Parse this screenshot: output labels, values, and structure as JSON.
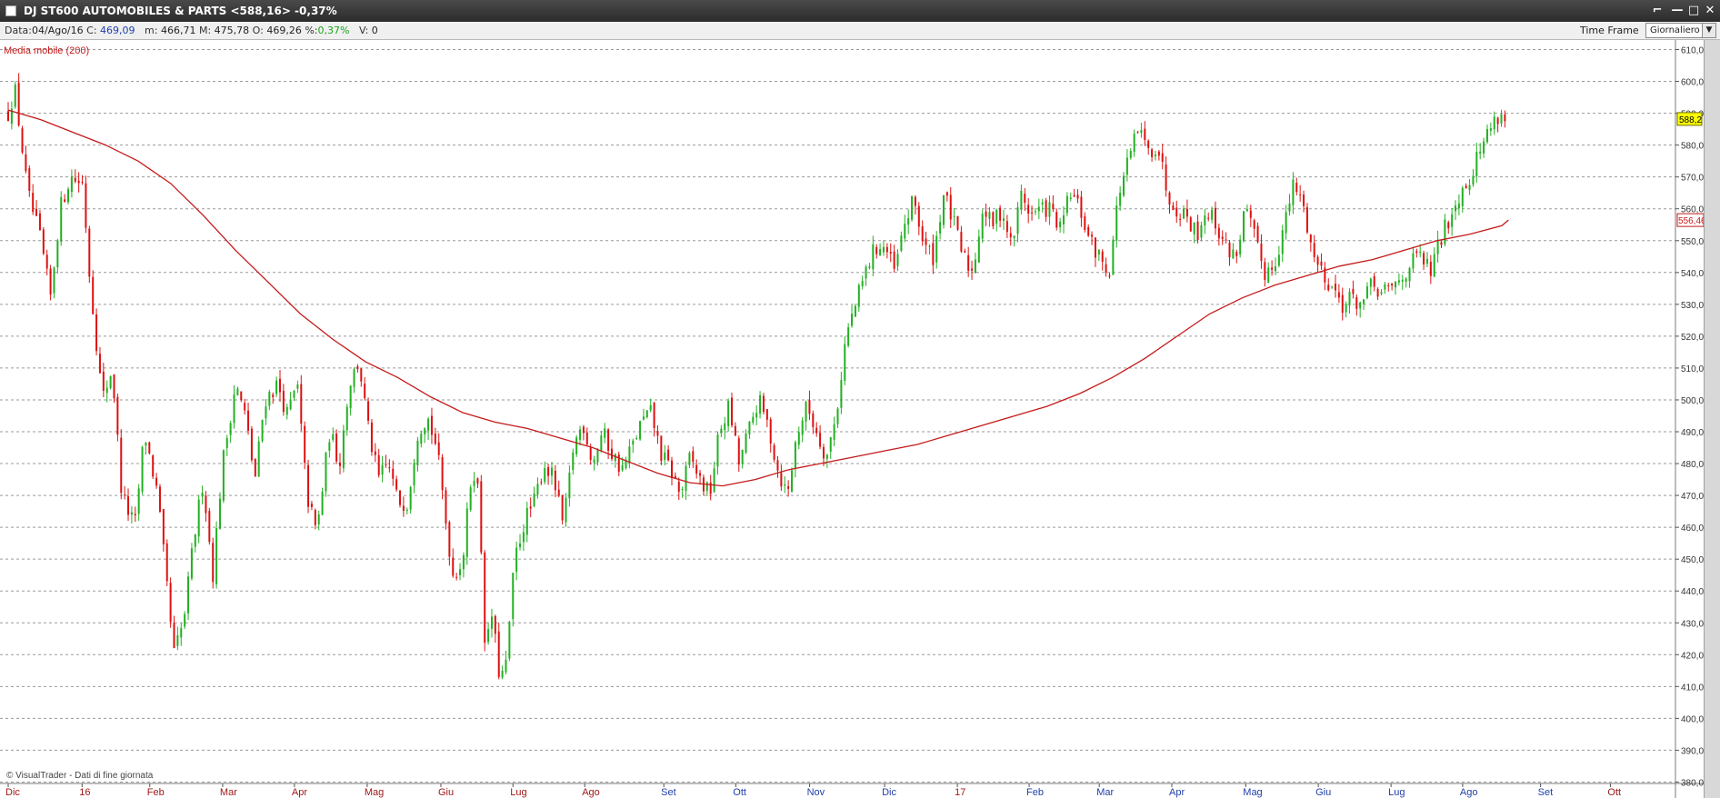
{
  "window": {
    "title": "DJ ST600 AUTOMOBILES & PARTS <588,16> -0,37%",
    "controls": {
      "tool": "⌐",
      "minimize": "—",
      "maximize": "□",
      "close": "✕"
    }
  },
  "infobar": {
    "date_label": "Data:",
    "date_value": "04/Ago/16",
    "close_label": "C:",
    "close_value": "469,09",
    "min_label": "m:",
    "min_value": "466,71",
    "max_label": "M:",
    "max_value": "475,78",
    "open_label": "O:",
    "open_value": "469,26",
    "change_label": "%:",
    "change_value": "0,37%",
    "volume_label": "V:",
    "volume_value": "0",
    "timeframe_label": "Time Frame",
    "timeframe_value": "Giornaliero"
  },
  "colors": {
    "up": "#22b022",
    "down": "#dd1111",
    "ma_line": "#c41a1a",
    "grid": "#9a9a9a",
    "last_price_bg": "#ffff00"
  },
  "chart_data": {
    "type": "candlestick",
    "instrument": "DJ ST600 AUTOMOBILES & PARTS",
    "indicator_label": "Media mobile (200)",
    "footer": "© VisualTrader - Dati di fine giornata",
    "ylim": [
      375,
      613
    ],
    "y_ticks": [
      "380,0",
      "390,0",
      "400,0",
      "410,0",
      "420,0",
      "430,0",
      "440,0",
      "450,0",
      "460,0",
      "470,0",
      "480,0",
      "490,0",
      "500,0",
      "510,0",
      "520,0",
      "530,0",
      "540,0",
      "550,0",
      "560,0",
      "570,0",
      "580,0",
      "590,0",
      "600,0",
      "610,0"
    ],
    "x_ticks": [
      {
        "label": "Dic",
        "t": 0,
        "blue": false
      },
      {
        "label": "16",
        "t": 0.0455,
        "blue": false
      },
      {
        "label": "Feb",
        "t": 0.0872,
        "blue": false
      },
      {
        "label": "Mar",
        "t": 0.1321,
        "blue": false
      },
      {
        "label": "Apr",
        "t": 0.1763,
        "blue": false
      },
      {
        "label": "Mag",
        "t": 0.2211,
        "blue": false
      },
      {
        "label": "Giu",
        "t": 0.2665,
        "blue": false
      },
      {
        "label": "Lug",
        "t": 0.3109,
        "blue": false
      },
      {
        "label": "Ago",
        "t": 0.3551,
        "blue": false
      },
      {
        "label": "Set",
        "t": 0.4038,
        "blue": true
      },
      {
        "label": "Ott",
        "t": 0.4481,
        "blue": true
      },
      {
        "label": "Nov",
        "t": 0.4936,
        "blue": true
      },
      {
        "label": "Dic",
        "t": 0.5398,
        "blue": true
      },
      {
        "label": "17",
        "t": 0.5846,
        "blue": false
      },
      {
        "label": "Feb",
        "t": 0.6288,
        "blue": true
      },
      {
        "label": "Mar",
        "t": 0.672,
        "blue": true
      },
      {
        "label": "Apr",
        "t": 0.7167,
        "blue": true
      },
      {
        "label": "Mag",
        "t": 0.7622,
        "blue": true
      },
      {
        "label": "Giu",
        "t": 0.8069,
        "blue": true
      },
      {
        "label": "Lug",
        "t": 0.8517,
        "blue": true
      },
      {
        "label": "Ago",
        "t": 0.8958,
        "blue": true
      },
      {
        "label": "Set",
        "t": 0.9438,
        "blue": true
      },
      {
        "label": "Ott",
        "t": 0.9868,
        "blue": false
      }
    ],
    "close_keypoints": [
      [
        0.0,
        590
      ],
      [
        0.004,
        598
      ],
      [
        0.012,
        565
      ],
      [
        0.02,
        550
      ],
      [
        0.026,
        532
      ],
      [
        0.032,
        560
      ],
      [
        0.038,
        570
      ],
      [
        0.046,
        568
      ],
      [
        0.05,
        540
      ],
      [
        0.058,
        500
      ],
      [
        0.064,
        510
      ],
      [
        0.07,
        470
      ],
      [
        0.078,
        460
      ],
      [
        0.084,
        490
      ],
      [
        0.092,
        470
      ],
      [
        0.096,
        450
      ],
      [
        0.102,
        420
      ],
      [
        0.108,
        430
      ],
      [
        0.114,
        455
      ],
      [
        0.12,
        475
      ],
      [
        0.126,
        445
      ],
      [
        0.132,
        480
      ],
      [
        0.14,
        505
      ],
      [
        0.146,
        495
      ],
      [
        0.152,
        475
      ],
      [
        0.158,
        500
      ],
      [
        0.166,
        505
      ],
      [
        0.172,
        495
      ],
      [
        0.178,
        505
      ],
      [
        0.184,
        470
      ],
      [
        0.19,
        458
      ],
      [
        0.198,
        490
      ],
      [
        0.204,
        480
      ],
      [
        0.21,
        505
      ],
      [
        0.216,
        512
      ],
      [
        0.222,
        490
      ],
      [
        0.228,
        475
      ],
      [
        0.234,
        480
      ],
      [
        0.24,
        468
      ],
      [
        0.246,
        468
      ],
      [
        0.252,
        490
      ],
      [
        0.258,
        495
      ],
      [
        0.264,
        485
      ],
      [
        0.27,
        460
      ],
      [
        0.274,
        445
      ],
      [
        0.28,
        450
      ],
      [
        0.286,
        480
      ],
      [
        0.29,
        470
      ],
      [
        0.294,
        420
      ],
      [
        0.298,
        433
      ],
      [
        0.302,
        415
      ],
      [
        0.306,
        413
      ],
      [
        0.312,
        450
      ],
      [
        0.318,
        462
      ],
      [
        0.324,
        468
      ],
      [
        0.33,
        480
      ],
      [
        0.336,
        475
      ],
      [
        0.342,
        460
      ],
      [
        0.348,
        485
      ],
      [
        0.354,
        493
      ],
      [
        0.36,
        480
      ],
      [
        0.366,
        490
      ],
      [
        0.372,
        483
      ],
      [
        0.378,
        478
      ],
      [
        0.384,
        485
      ],
      [
        0.39,
        493
      ],
      [
        0.396,
        496
      ],
      [
        0.402,
        483
      ],
      [
        0.408,
        478
      ],
      [
        0.414,
        470
      ],
      [
        0.42,
        482
      ],
      [
        0.426,
        475
      ],
      [
        0.432,
        470
      ],
      [
        0.438,
        490
      ],
      [
        0.444,
        498
      ],
      [
        0.45,
        480
      ],
      [
        0.456,
        490
      ],
      [
        0.462,
        500
      ],
      [
        0.468,
        492
      ],
      [
        0.474,
        478
      ],
      [
        0.48,
        470
      ],
      [
        0.486,
        490
      ],
      [
        0.492,
        498
      ],
      [
        0.498,
        490
      ],
      [
        0.504,
        482
      ],
      [
        0.51,
        495
      ],
      [
        0.516,
        520
      ],
      [
        0.522,
        530
      ],
      [
        0.528,
        540
      ],
      [
        0.534,
        548
      ],
      [
        0.54,
        548
      ],
      [
        0.546,
        540
      ],
      [
        0.552,
        555
      ],
      [
        0.558,
        563
      ],
      [
        0.564,
        548
      ],
      [
        0.57,
        545
      ],
      [
        0.576,
        565
      ],
      [
        0.582,
        556
      ],
      [
        0.588,
        545
      ],
      [
        0.594,
        540
      ],
      [
        0.6,
        560
      ],
      [
        0.606,
        555
      ],
      [
        0.612,
        560
      ],
      [
        0.618,
        548
      ],
      [
        0.624,
        565
      ],
      [
        0.63,
        558
      ],
      [
        0.636,
        560
      ],
      [
        0.642,
        560
      ],
      [
        0.648,
        553
      ],
      [
        0.654,
        565
      ],
      [
        0.66,
        560
      ],
      [
        0.666,
        550
      ],
      [
        0.672,
        545
      ],
      [
        0.678,
        540
      ],
      [
        0.684,
        565
      ],
      [
        0.69,
        575
      ],
      [
        0.696,
        585
      ],
      [
        0.702,
        578
      ],
      [
        0.708,
        580
      ],
      [
        0.714,
        565
      ],
      [
        0.72,
        560
      ],
      [
        0.726,
        558
      ],
      [
        0.732,
        552
      ],
      [
        0.738,
        560
      ],
      [
        0.744,
        555
      ],
      [
        0.75,
        548
      ],
      [
        0.756,
        545
      ],
      [
        0.762,
        560
      ],
      [
        0.768,
        550
      ],
      [
        0.774,
        540
      ],
      [
        0.78,
        543
      ],
      [
        0.786,
        555
      ],
      [
        0.792,
        568
      ],
      [
        0.798,
        560
      ],
      [
        0.804,
        545
      ],
      [
        0.81,
        540
      ],
      [
        0.816,
        535
      ],
      [
        0.822,
        530
      ],
      [
        0.828,
        532
      ],
      [
        0.834,
        530
      ],
      [
        0.84,
        536
      ],
      [
        0.846,
        533
      ],
      [
        0.852,
        535
      ],
      [
        0.858,
        538
      ],
      [
        0.864,
        543
      ],
      [
        0.87,
        545
      ],
      [
        0.876,
        540
      ],
      [
        0.882,
        550
      ],
      [
        0.888,
        558
      ],
      [
        0.894,
        565
      ],
      [
        0.9,
        570
      ],
      [
        0.906,
        578
      ],
      [
        0.912,
        585
      ],
      [
        0.918,
        590
      ],
      [
        0.924,
        588
      ]
    ],
    "ma_200": [
      [
        0.0,
        591
      ],
      [
        0.02,
        588
      ],
      [
        0.04,
        584
      ],
      [
        0.06,
        580
      ],
      [
        0.08,
        575
      ],
      [
        0.1,
        568
      ],
      [
        0.12,
        558
      ],
      [
        0.14,
        547
      ],
      [
        0.16,
        537
      ],
      [
        0.18,
        527
      ],
      [
        0.2,
        519
      ],
      [
        0.22,
        512
      ],
      [
        0.24,
        507
      ],
      [
        0.26,
        501
      ],
      [
        0.28,
        496
      ],
      [
        0.3,
        493
      ],
      [
        0.32,
        491
      ],
      [
        0.34,
        488
      ],
      [
        0.36,
        485
      ],
      [
        0.38,
        481
      ],
      [
        0.4,
        477
      ],
      [
        0.42,
        474
      ],
      [
        0.44,
        473
      ],
      [
        0.46,
        475
      ],
      [
        0.48,
        478
      ],
      [
        0.5,
        480
      ],
      [
        0.52,
        482
      ],
      [
        0.54,
        484
      ],
      [
        0.56,
        486
      ],
      [
        0.58,
        489
      ],
      [
        0.6,
        492
      ],
      [
        0.62,
        495
      ],
      [
        0.64,
        498
      ],
      [
        0.66,
        502
      ],
      [
        0.68,
        507
      ],
      [
        0.7,
        513
      ],
      [
        0.72,
        520
      ],
      [
        0.74,
        527
      ],
      [
        0.76,
        532
      ],
      [
        0.78,
        536
      ],
      [
        0.8,
        539
      ],
      [
        0.82,
        542
      ],
      [
        0.84,
        544
      ],
      [
        0.86,
        547
      ],
      [
        0.88,
        550
      ],
      [
        0.9,
        552
      ],
      [
        0.92,
        554.7
      ],
      [
        0.924,
        556.46
      ]
    ],
    "last_price": {
      "value": 588.2,
      "label": "588,2"
    },
    "ma_last": {
      "value": 556.46,
      "label": "556,46"
    }
  }
}
